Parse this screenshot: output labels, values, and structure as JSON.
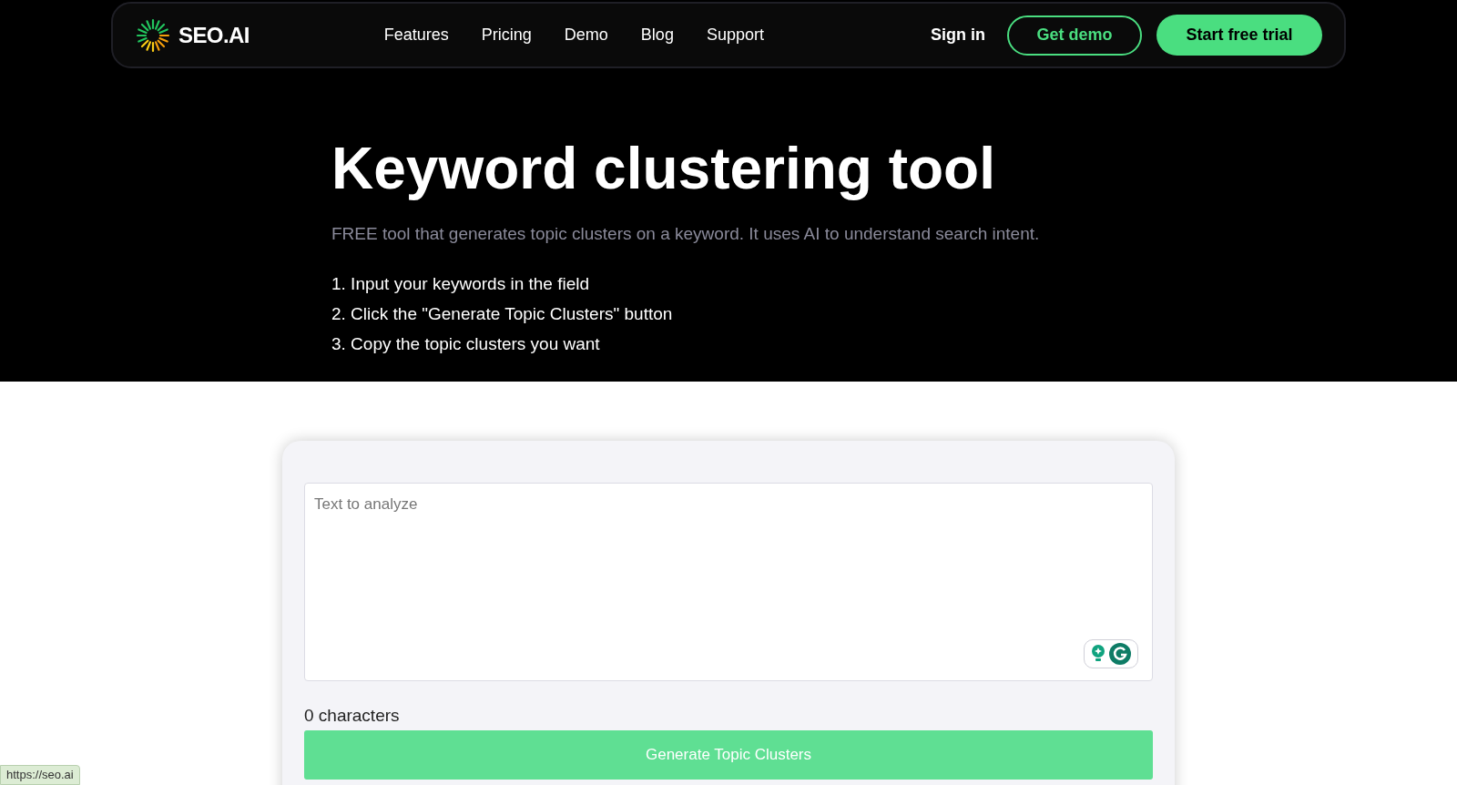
{
  "nav": {
    "logo": "SEO.AI",
    "links": [
      "Features",
      "Pricing",
      "Demo",
      "Blog",
      "Support"
    ],
    "sign_in": "Sign in",
    "get_demo": "Get demo",
    "start_trial": "Start free trial"
  },
  "hero": {
    "title": "Keyword clustering tool",
    "subtitle": "FREE tool that generates topic clusters on a keyword. It uses AI to understand search intent.",
    "steps": [
      "1. Input your keywords in the field",
      "2. Click the \"Generate Topic Clusters\" button",
      "3. Copy the topic clusters you want"
    ]
  },
  "tool": {
    "placeholder": "Text to analyze",
    "count": "0 characters",
    "button": "Generate Topic Clusters"
  },
  "status_bar": {
    "url": "https://seo.ai"
  }
}
